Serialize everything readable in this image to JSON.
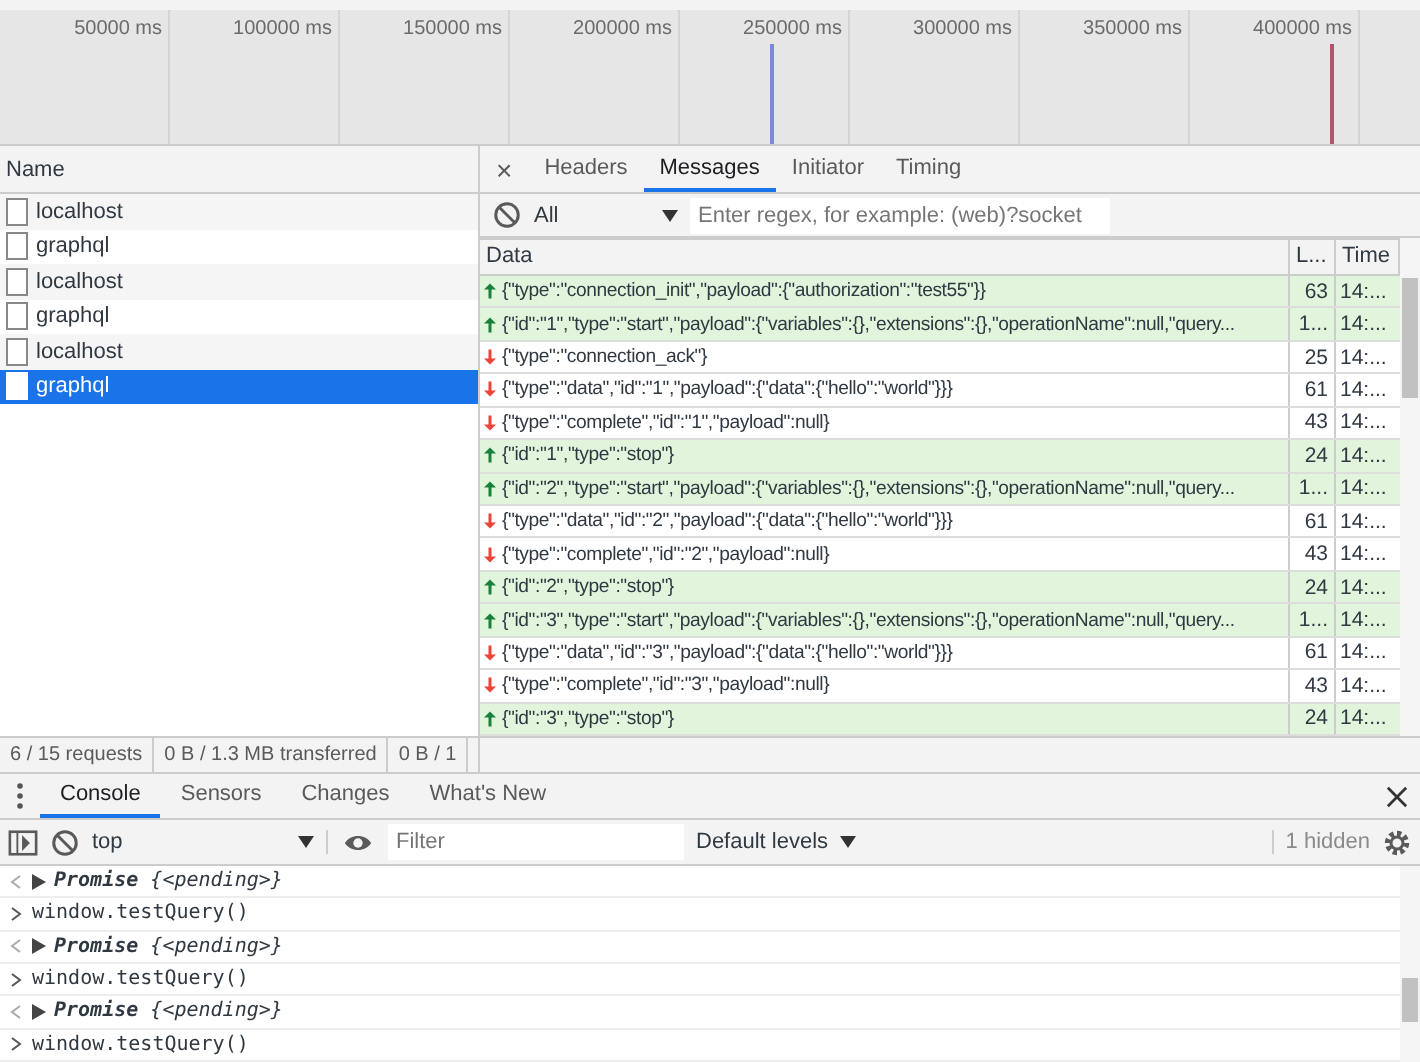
{
  "timeline": {
    "ticks": [
      "50000 ms",
      "100000 ms",
      "150000 ms",
      "200000 ms",
      "250000 ms",
      "300000 ms",
      "350000 ms",
      "400000 ms"
    ]
  },
  "requests": {
    "header": "Name",
    "items": [
      {
        "name": "localhost",
        "selected": false
      },
      {
        "name": "graphql",
        "selected": false
      },
      {
        "name": "localhost",
        "selected": false
      },
      {
        "name": "graphql",
        "selected": false
      },
      {
        "name": "localhost",
        "selected": false
      },
      {
        "name": "graphql",
        "selected": true
      }
    ]
  },
  "detail": {
    "close": "×",
    "tabs": [
      {
        "label": "Headers",
        "selected": false
      },
      {
        "label": "Messages",
        "selected": true
      },
      {
        "label": "Initiator",
        "selected": false
      },
      {
        "label": "Timing",
        "selected": false
      }
    ],
    "filter": {
      "type": "All",
      "placeholder": "Enter regex, for example: (web)?socket"
    },
    "columns": [
      "Data",
      "L...",
      "Time"
    ],
    "messages": [
      {
        "kind": "sent",
        "data": "{\"type\":\"connection_init\",\"payload\":{\"authorization\":\"test55\"}}",
        "length": "63",
        "time": "14:..."
      },
      {
        "kind": "sent",
        "data": "{\"id\":\"1\",\"type\":\"start\",\"payload\":{\"variables\":{},\"extensions\":{},\"operationName\":null,\"query...",
        "length": "1...",
        "time": "14:..."
      },
      {
        "kind": "received",
        "data": "{\"type\":\"connection_ack\"}",
        "length": "25",
        "time": "14:..."
      },
      {
        "kind": "received",
        "data": "{\"type\":\"data\",\"id\":\"1\",\"payload\":{\"data\":{\"hello\":\"world\"}}}",
        "length": "61",
        "time": "14:..."
      },
      {
        "kind": "received",
        "data": "{\"type\":\"complete\",\"id\":\"1\",\"payload\":null}",
        "length": "43",
        "time": "14:..."
      },
      {
        "kind": "sent",
        "data": "{\"id\":\"1\",\"type\":\"stop\"}",
        "length": "24",
        "time": "14:..."
      },
      {
        "kind": "sent",
        "data": "{\"id\":\"2\",\"type\":\"start\",\"payload\":{\"variables\":{},\"extensions\":{},\"operationName\":null,\"query...",
        "length": "1...",
        "time": "14:..."
      },
      {
        "kind": "received",
        "data": "{\"type\":\"data\",\"id\":\"2\",\"payload\":{\"data\":{\"hello\":\"world\"}}}",
        "length": "61",
        "time": "14:..."
      },
      {
        "kind": "received",
        "data": "{\"type\":\"complete\",\"id\":\"2\",\"payload\":null}",
        "length": "43",
        "time": "14:..."
      },
      {
        "kind": "sent",
        "data": "{\"id\":\"2\",\"type\":\"stop\"}",
        "length": "24",
        "time": "14:..."
      },
      {
        "kind": "sent",
        "data": "{\"id\":\"3\",\"type\":\"start\",\"payload\":{\"variables\":{},\"extensions\":{},\"operationName\":null,\"query...",
        "length": "1...",
        "time": "14:..."
      },
      {
        "kind": "received",
        "data": "{\"type\":\"data\",\"id\":\"3\",\"payload\":{\"data\":{\"hello\":\"world\"}}}",
        "length": "61",
        "time": "14:..."
      },
      {
        "kind": "received",
        "data": "{\"type\":\"complete\",\"id\":\"3\",\"payload\":null}",
        "length": "43",
        "time": "14:..."
      },
      {
        "kind": "sent",
        "data": "{\"id\":\"3\",\"type\":\"stop\"}",
        "length": "24",
        "time": "14:..."
      }
    ]
  },
  "status_bar": [
    "6 / 15 requests",
    "0 B / 1.3 MB transferred",
    "0 B / 1"
  ],
  "drawer": {
    "tabs": [
      {
        "label": "Console",
        "selected": true
      },
      {
        "label": "Sensors",
        "selected": false
      },
      {
        "label": "Changes",
        "selected": false
      },
      {
        "label": "What's New",
        "selected": false
      }
    ],
    "context": "top",
    "filter_placeholder": "Filter",
    "levels": "Default levels",
    "hidden": "1 hidden",
    "lines": [
      {
        "kind": "output",
        "text": "**Promise** {<pending>}"
      },
      {
        "kind": "input",
        "text": "window.testQuery()"
      },
      {
        "kind": "output",
        "text": "**Promise** {<pending>}"
      },
      {
        "kind": "input",
        "text": "window.testQuery()"
      },
      {
        "kind": "output",
        "text": "**Promise** {<pending>}"
      },
      {
        "kind": "input",
        "text": "window.testQuery()"
      }
    ]
  }
}
